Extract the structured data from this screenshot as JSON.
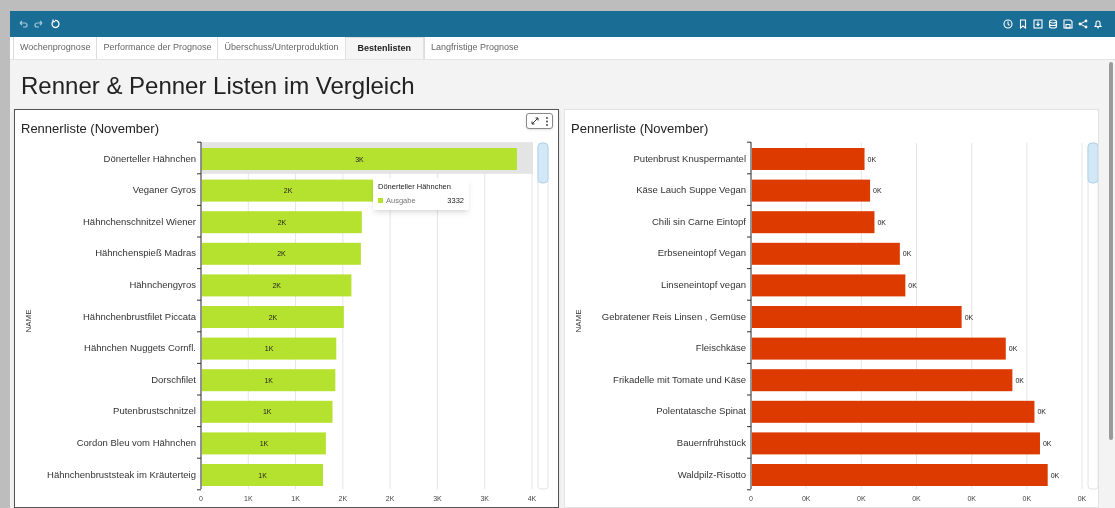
{
  "tabs": [
    {
      "label": "Wochenprognose",
      "selected": false
    },
    {
      "label": "Performance der Prognose",
      "selected": false
    },
    {
      "label": "Überschuss/Unterproduktion",
      "selected": false
    },
    {
      "label": "Bestenlisten",
      "selected": true
    },
    {
      "label": "Langfristige Prognose",
      "selected": false
    }
  ],
  "page_title": "Renner & Penner Listen im Vergleich",
  "cards": [
    {
      "title": "Rennerliste (November)",
      "selected": true,
      "kind": "inside-labels",
      "chart_data": {
        "type": "bar",
        "orientation": "horizontal",
        "ylabel": "NAME",
        "grid": true,
        "categories": [
          "Dönerteller Hähnchen",
          "Veganer Gyros",
          "Hähnchenschnitzel Wiener",
          "Hähnchenspieß Madras",
          "Hähnchengyros",
          "Hähnchenbrustfilet Piccata",
          "Hähnchen Nuggets Cornfl.",
          "Dorschfilet",
          "Putenbrustschnitzel",
          "Cordon Bleu vom Hähnchen",
          "Hähnchenbruststeak im Kräuterteig"
        ],
        "series": [
          {
            "name": "Ausgabe",
            "color": "#b5e22e",
            "values": [
              3330,
              1820,
              1690,
              1680,
              1580,
              1500,
              1420,
              1410,
              1380,
              1310,
              1280
            ]
          }
        ],
        "value_labels": [
          "3K",
          "2K",
          "2K",
          "2K",
          "2K",
          "2K",
          "1K",
          "1K",
          "1K",
          "1K",
          "1K"
        ],
        "xlim": [
          0,
          3500
        ],
        "xticks": [
          {
            "value": 0,
            "label": "0"
          },
          {
            "value": 500,
            "label": "1K"
          },
          {
            "value": 1000,
            "label": "1K"
          },
          {
            "value": 1500,
            "label": "2K"
          },
          {
            "value": 2000,
            "label": "2K"
          },
          {
            "value": 2500,
            "label": "3K"
          },
          {
            "value": 3000,
            "label": "3K"
          },
          {
            "value": 3500,
            "label": "4K"
          }
        ],
        "bands": [
          {
            "axis": "y",
            "from": "Dönerteller Hähnchen",
            "to": "Dönerteller Hähnchen",
            "color": "#e4e4e4"
          }
        ]
      },
      "tooltip": {
        "title": "Dönerteller Hähnchen",
        "value": "3332"
      }
    },
    {
      "title": "Pennerliste (November)",
      "selected": false,
      "kind": "outside-labels",
      "chart_data": {
        "type": "bar",
        "orientation": "horizontal",
        "ylabel": "NAME",
        "grid": true,
        "categories": [
          "Putenbrust Knuspermantel",
          "Käse Lauch Suppe Vegan",
          "Chili sin Carne Eintopf",
          "Erbseneintopf Vegan",
          "Linseneintopf vegan",
          "Gebratener Reis Linsen , Gemüse",
          "Fleischkäse",
          "Frikadelle mit Tomate und Käse",
          "Polentatasche Spinat",
          "Bauernfrühstück",
          "Waldpilz-Risotto"
        ],
        "series": [
          {
            "color": "#dd3a00",
            "values": [
              102,
              107,
              111,
              134,
              139,
              190,
              230,
              236,
              256,
              261,
              268
            ]
          }
        ],
        "value_labels": [
          "0K",
          "0K",
          "0K",
          "0K",
          "0K",
          "0K",
          "0K",
          "0K",
          "0K",
          "0K",
          "0K"
        ],
        "xlim": [
          0,
          300
        ],
        "xticks": [
          {
            "value": 0,
            "label": "0"
          },
          {
            "value": 50,
            "label": "0K"
          },
          {
            "value": 100,
            "label": "0K"
          },
          {
            "value": 150,
            "label": "0K"
          },
          {
            "value": 200,
            "label": "0K"
          },
          {
            "value": 250,
            "label": "0K"
          },
          {
            "value": 300,
            "label": "0K"
          }
        ]
      }
    }
  ]
}
